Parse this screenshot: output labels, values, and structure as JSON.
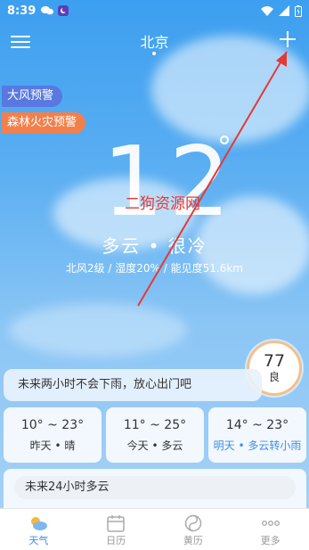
{
  "status_bar": {
    "time": "8:39"
  },
  "header": {
    "city": "北京"
  },
  "alerts": [
    {
      "label": "大风预警",
      "color": "#5978e0"
    },
    {
      "label": "森林火灾预警",
      "color": "#f1804d"
    }
  ],
  "current": {
    "temperature": "12",
    "condition": "多云 • 很冷",
    "details": "北风2级 / 湿度20% / 能见度51.6km"
  },
  "watermark": "二狗资源网",
  "aqi": {
    "value": "77",
    "level": "良"
  },
  "rain_notice": "未来两小时不会下雨，放心出门吧",
  "forecast": [
    {
      "range": "10° ~ 23°",
      "desc": "昨天 • 晴"
    },
    {
      "range": "11° ~ 25°",
      "desc": "今天 • 多云"
    },
    {
      "range": "14° ~ 23°",
      "desc": "明天 • 多云转小雨"
    }
  ],
  "summary_24h": "未来24小时多云",
  "tabs": [
    {
      "label": "天气",
      "icon": "weather-icon",
      "active": true
    },
    {
      "label": "日历",
      "icon": "calendar-icon",
      "active": false
    },
    {
      "label": "黄历",
      "icon": "almanac-icon",
      "active": false
    },
    {
      "label": "更多",
      "icon": "more-icon",
      "active": false
    }
  ],
  "colors": {
    "accent": "#3f8fe6",
    "annotation_red": "#e53935"
  }
}
